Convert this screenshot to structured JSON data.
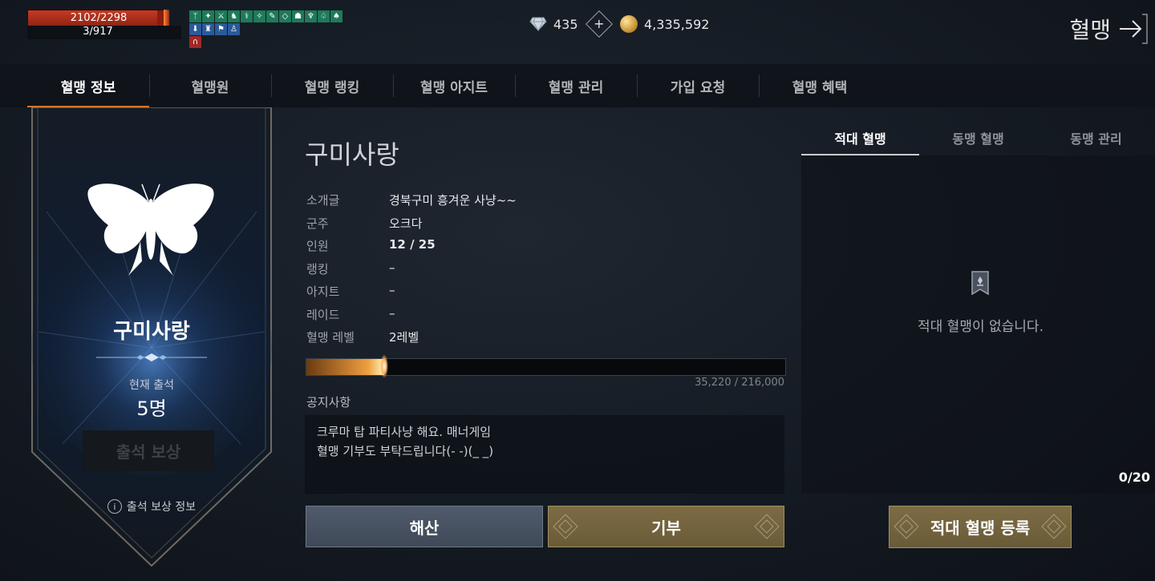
{
  "hud": {
    "hp_text": "2102/2298",
    "hp_fraction": 0.915,
    "level_text": "3/917",
    "buff_icons_row1": [
      "ᛘ",
      "✦",
      "⚔",
      "♞",
      "⚕",
      "✧",
      "✎",
      "◇",
      "☗",
      "♆",
      "♤",
      "♠"
    ],
    "buff_icons_row2": [
      "⬇",
      "♜",
      "⚑",
      "♙"
    ],
    "debuff_icons": [
      "∩"
    ]
  },
  "currency": {
    "diamond_icon": "diamond-icon",
    "diamond_amount": "435",
    "plus_glyph": "+",
    "coin_icon": "coin-icon",
    "gold_amount": "4,335,592"
  },
  "page_title": "혈맹",
  "tabs": [
    "혈맹 정보",
    "혈맹원",
    "혈맹 랭킹",
    "혈맹 아지트",
    "혈맹 관리",
    "가입 요청",
    "혈맹 혜택"
  ],
  "active_tab": 0,
  "banner": {
    "emblem_icon": "butterfly-icon",
    "clan_name": "구미사랑",
    "attendance_label": "현재 출석",
    "attendance_count": "5명",
    "reward_button": "출석 보상",
    "reward_info_glyph": "i",
    "reward_info": "출석 보상 정보"
  },
  "info": {
    "clan_name": "구미사랑",
    "rows": [
      {
        "key": "소개글",
        "value": "경북구미 흥겨운 사냥~~"
      },
      {
        "key": "군주",
        "value": "오크다"
      },
      {
        "key": "인원",
        "value": "12 / 25"
      },
      {
        "key": "랭킹",
        "value": "–"
      },
      {
        "key": "아지트",
        "value": "–"
      },
      {
        "key": "레이드",
        "value": "–"
      },
      {
        "key": "혈맹 레벨",
        "value": "2레벨"
      }
    ],
    "xp_current": 35220,
    "xp_max": 216000,
    "xp_text": "35,220 / 216,000",
    "notice_label": "공지사항",
    "notice_lines": [
      "크루마 탑 파티사냥 해요. 매너게임",
      "혈맹 기부도 부탁드립니다(- -)(_ _)"
    ]
  },
  "buttons": {
    "disband": "해산",
    "donate": "기부",
    "register_enemy": "적대 혈맹 등록"
  },
  "right_panel": {
    "tabs": [
      "적대 혈맹",
      "동맹 혈맹",
      "동맹 관리"
    ],
    "active_tab": 0,
    "empty_icon": "banner-icon",
    "empty_text": "적대 혈맹이 없습니다.",
    "count": "0/20"
  },
  "colors": {
    "accent": "#d7742b",
    "gold_button": "#74653f",
    "disband_button": "#4a5464",
    "hp": "#b7301c"
  }
}
